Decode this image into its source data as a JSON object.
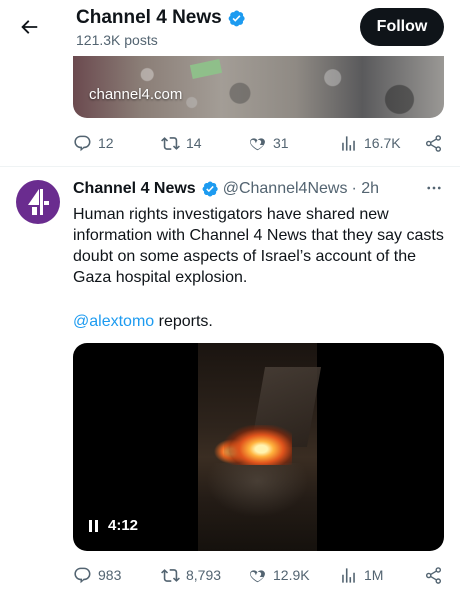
{
  "header": {
    "name": "Channel 4 News",
    "post_count": "121.3K posts",
    "follow_label": "Follow"
  },
  "previous_post": {
    "media_watermark": "channel4.com",
    "stats": {
      "replies": "12",
      "reposts": "14",
      "likes": "31",
      "views": "16.7K"
    }
  },
  "tweet": {
    "author_name": "Channel 4 News",
    "handle": "@Channel4News",
    "time": "· 2h",
    "text": "Human rights investigators have shared new information with Channel 4 News that they say casts doubt on some aspects of Israel’s account of the Gaza hospital explosion.",
    "mention": "@alextomo",
    "mention_suffix": " reports.",
    "video": {
      "duration": "4:12"
    },
    "stats": {
      "replies": "983",
      "reposts": "8,793",
      "likes": "12.9K",
      "views": "1M"
    }
  },
  "colors": {
    "verified": "#1d9bf0",
    "avatar_bg": "#6a2c8f",
    "link": "#1d9bf0",
    "muted": "#536471"
  },
  "icons": [
    "back-arrow-icon",
    "verified-badge-icon",
    "more-icon",
    "reply-icon",
    "repost-icon",
    "like-icon",
    "views-icon",
    "share-icon",
    "pause-icon",
    "channel4-logo"
  ]
}
